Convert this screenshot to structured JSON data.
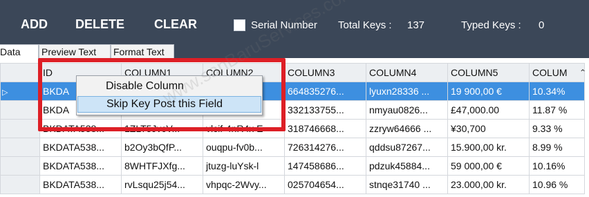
{
  "toolbar": {
    "add_label": "ADD",
    "delete_label": "DELETE",
    "clear_label": "CLEAR",
    "serial_number_label": "Serial Number",
    "total_keys_label": "Total Keys :",
    "total_keys_value": "137",
    "typed_keys_label": "Typed Keys :",
    "typed_keys_value": "0"
  },
  "tabs": [
    "Data",
    "Preview Text",
    "Format Text"
  ],
  "grid": {
    "columns": [
      "ID",
      "COLUMN1",
      "COLUMN2",
      "COLUMN3",
      "COLUMN4",
      "COLUMN5",
      "COLUM"
    ],
    "rows": [
      [
        "BKDA",
        "",
        "B",
        "664835276...",
        "lyuxn28336 ...",
        "19 900,00 €",
        "10.34%"
      ],
      [
        "BKDA",
        "",
        "C",
        "332133755...",
        "nmyau0826...",
        "£47,000.00",
        "11.87 %"
      ],
      [
        "BKDATA538...",
        "1ZLT5JvcV...",
        "vlcif-4nR4x E",
        "318746668...",
        "zzryw64666 ...",
        "¥30,700",
        "9.33 %"
      ],
      [
        "BKDATA538...",
        "b2Oy3bQfP...",
        "ouqpu-fv0b...",
        "726314276...",
        "qddsu87267...",
        "15.900,00 kr.",
        "8.99 %"
      ],
      [
        "BKDATA538...",
        "8WHTFJXfg...",
        "jtuzg-luYsk-l",
        "147458686...",
        "pdzuk45884...",
        "59 000,00 €",
        "10.16%"
      ],
      [
        "BKDATA538...",
        "rvLsqu25j54...",
        "vhpqc-2Wvy...",
        "025704654...",
        "stnqe31740 ...",
        "23.000,00 kr.",
        "10.96 %"
      ]
    ]
  },
  "context_menu": {
    "items": [
      "Disable Column",
      "Skip Key Post this Field"
    ]
  },
  "watermark_text": "www.sanBaruServices.com",
  "colors": {
    "toolbar_bg": "#3b4758",
    "selection_blue": "#3d8fe0",
    "highlight_red": "#dd1f26"
  },
  "icons": {
    "row_indicator": "triangle-right-icon",
    "scroll_up": "chevron-up-icon"
  }
}
